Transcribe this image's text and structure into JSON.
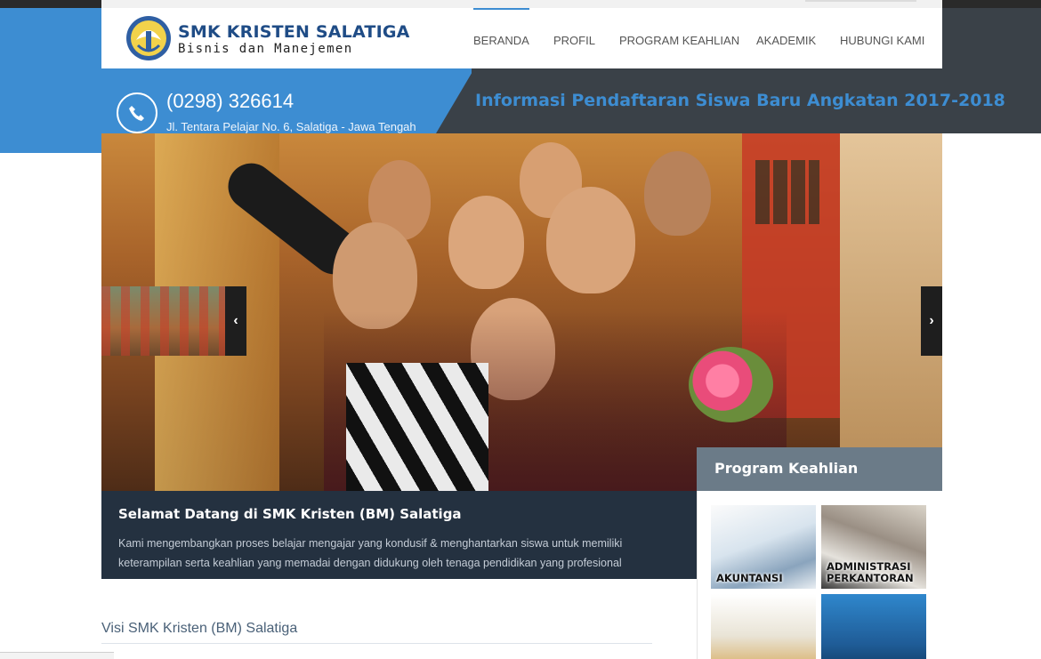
{
  "site": {
    "name": "SMK KRISTEN SALATIGA",
    "subtitle": "Bisnis dan Manejemen"
  },
  "nav": {
    "items": [
      {
        "label": "BERANDA",
        "active": true
      },
      {
        "label": "PROFIL",
        "active": false
      },
      {
        "label": "PROGRAM KEAHLIAN",
        "active": false
      },
      {
        "label": "AKADEMIK",
        "active": false
      },
      {
        "label": "HUBUNGI KAMI",
        "active": false
      }
    ]
  },
  "contact": {
    "phone": "(0298) 326614",
    "address": "Jl. Tentara Pelajar No. 6, Salatiga - Jawa Tengah",
    "icon": "phone-icon"
  },
  "announcement": "Informasi Pendaftaran Siswa Baru Angkatan 2017-2018",
  "slider": {
    "prev_label": "‹",
    "next_label": "›",
    "caption_title": "Selamat Datang di SMK Kristen (BM) Salatiga",
    "caption_text": "Kami mengembangkan proses belajar mengajar yang kondusif & menghantarkan siswa untuk memiliki keterampilan serta keahlian yang memadai dengan didukung oleh tenaga pendidikan yang profesional"
  },
  "program": {
    "title": "Program Keahlian",
    "items": [
      {
        "label": "AKUNTANSI"
      },
      {
        "label": "ADMINISTRASI PERKANTORAN"
      },
      {
        "label": ""
      },
      {
        "label": ""
      }
    ]
  },
  "visi": {
    "title": "Visi SMK Kristen (BM) Salatiga"
  },
  "colors": {
    "brand_blue": "#3d8dd2",
    "dark_band": "#3a4148",
    "caption_bg": "#243140",
    "program_head": "#6b7b88"
  }
}
